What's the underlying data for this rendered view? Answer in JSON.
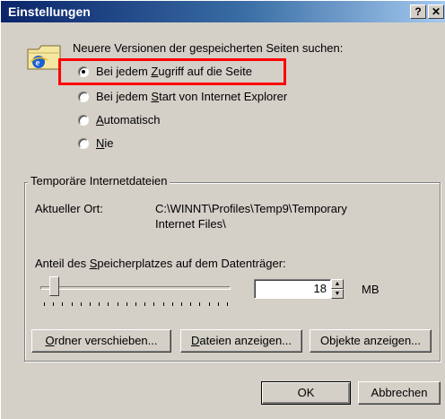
{
  "window": {
    "title": "Einstellungen",
    "help_label": "?",
    "close_label": "✕"
  },
  "check_section": {
    "prompt": "Neuere Versionen der gespeicherten Seiten suchen:",
    "options": [
      {
        "pre": "Bei jedem ",
        "key": "Z",
        "post": "ugriff auf die Seite",
        "selected": true
      },
      {
        "pre": "Bei jedem ",
        "key": "S",
        "post": "tart von Internet Explorer",
        "selected": false
      },
      {
        "pre": "",
        "key": "A",
        "post": "utomatisch",
        "selected": false
      },
      {
        "pre": "",
        "key": "N",
        "post": "ie",
        "selected": false
      }
    ],
    "highlight_color": "#ff0000"
  },
  "temp_files": {
    "legend": "Temporäre Internetdateien",
    "location_label": "Aktueller Ort:",
    "location_line1": "C:\\WINNT\\Profiles\\Temp9\\Temporary",
    "location_line2": "Internet Files\\",
    "disk_label_pre": "Anteil des ",
    "disk_label_key": "S",
    "disk_label_post": "peicherplatzes auf dem Datenträger:",
    "disk_mb": "18",
    "unit": "MB",
    "slider_fraction": 0.05
  },
  "buttons": {
    "move_pre": "",
    "move_key": "O",
    "move_post": "rdner verschieben...",
    "files_pre": "",
    "files_key": "D",
    "files_post": "ateien anzeigen...",
    "objects_pre": "Ob",
    "objects_key": "j",
    "objects_post": "ekte anzeigen...",
    "ok": "OK",
    "cancel": "Abbrechen"
  },
  "icons": {
    "app": "internet-explorer-folder-icon"
  }
}
